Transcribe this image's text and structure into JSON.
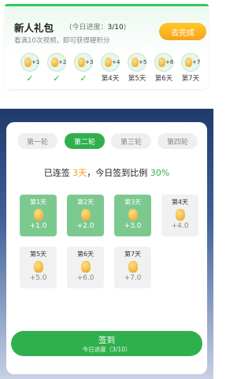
{
  "gift": {
    "title": "新人礼包",
    "progress_prefix": "(今日进度：",
    "progress_value": "3/10",
    "progress_suffix": ")",
    "description": "看满10次视频，即可获得硬积分",
    "action_label": "去完成",
    "days": [
      {
        "reward": "+1",
        "status": "checked",
        "label": "✓"
      },
      {
        "reward": "+2",
        "status": "checked",
        "label": "✓"
      },
      {
        "reward": "+3",
        "status": "checked",
        "label": "✓"
      },
      {
        "reward": "+4",
        "status": "pending",
        "label": "第4天"
      },
      {
        "reward": "+5",
        "status": "pending",
        "label": "第5天"
      },
      {
        "reward": "+6",
        "status": "pending",
        "label": "第6天"
      },
      {
        "reward": "+7",
        "status": "pending",
        "label": "第7天"
      }
    ]
  },
  "rounds": {
    "tabs": [
      "第一轮",
      "第二轮",
      "第三轮",
      "第四轮"
    ],
    "active_index": 1
  },
  "streak": {
    "prefix": "已连签 ",
    "days": "3天",
    "middle": "，今日签到比例 ",
    "percent": "30%"
  },
  "signin_days": [
    {
      "label": "第1天",
      "value": "+1.0",
      "done": true
    },
    {
      "label": "第2天",
      "value": "+2.0",
      "done": true
    },
    {
      "label": "第3天",
      "value": "+3.0",
      "done": true
    },
    {
      "label": "第4天",
      "value": "+4.0",
      "done": false
    },
    {
      "label": "第5天",
      "value": "+5.0",
      "done": false
    },
    {
      "label": "第6天",
      "value": "+6.0",
      "done": false
    },
    {
      "label": "第7天",
      "value": "+7.0",
      "done": false
    }
  ],
  "sign_button": {
    "label": "签到",
    "sub": "今日进度（3/10）"
  },
  "colors": {
    "accent_green": "#2fb04d",
    "accent_orange": "#f29a1b",
    "done_cell": "#7cc98f"
  }
}
